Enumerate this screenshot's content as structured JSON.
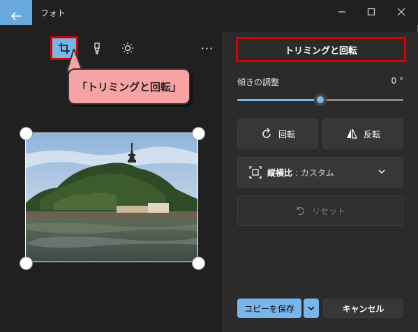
{
  "window": {
    "title": "フォト"
  },
  "toolbar": {
    "more_label": "···"
  },
  "callout": {
    "text": "「トリミングと回転」"
  },
  "panel": {
    "tab_label": "トリミングと回転",
    "straighten_label": "傾きの調整",
    "straighten_value": "0 °",
    "straighten_level": 0.5,
    "rotate_label": "回転",
    "flip_label": "反転",
    "aspect_label": "縦横比",
    "aspect_value": ": カスタム",
    "reset_label": "リセット",
    "save_copy_label": "コピーを保存",
    "cancel_label": "キャンセル"
  },
  "colors": {
    "accent": "#78b6ea",
    "highlight": "#d90000",
    "callout": "#f7a3a3"
  }
}
